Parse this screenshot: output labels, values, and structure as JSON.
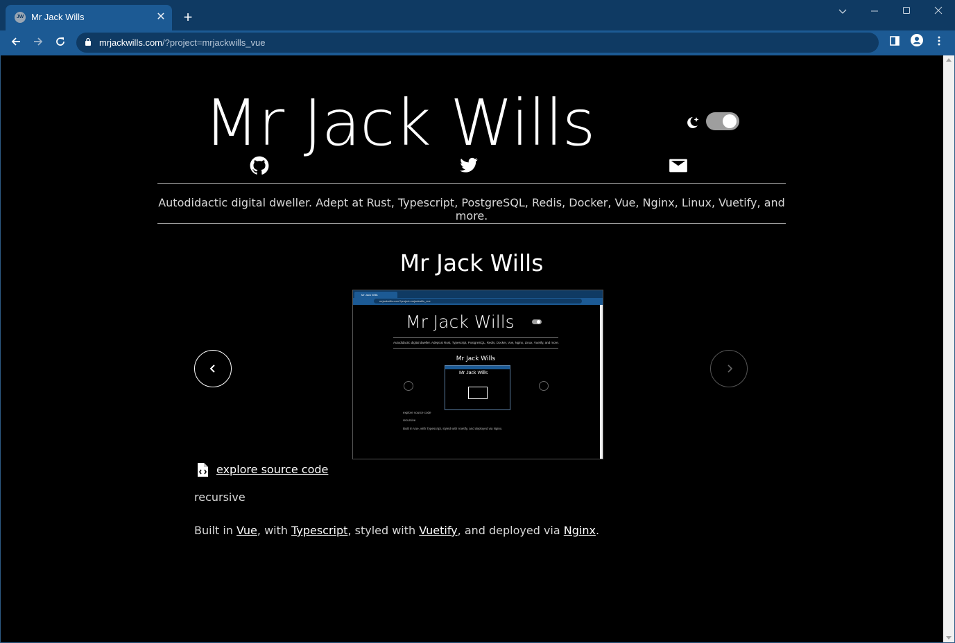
{
  "browser": {
    "tab_title": "Mr Jack Wills",
    "tab_favicon_text": "JW",
    "url_host": "mrjackwills.com",
    "url_path": "/?project=mrjackwills_vue"
  },
  "site": {
    "title": "Mr Jack Wills",
    "dark_mode_enabled": true,
    "social": [
      "github-icon",
      "twitter-icon",
      "email-icon"
    ],
    "tagline": "Autodidactic digital dweller. Adept at Rust, Typescript, PostgreSQL, Redis, Docker, Vue, Nginx, Linux, Vuetify, and more."
  },
  "project": {
    "title": "Mr Jack Wills",
    "source_link": "explore source code",
    "description": "recursive",
    "built": {
      "prefix": "Built in ",
      "t1": "Vue",
      "sep1": ", with ",
      "t2": "Typescript",
      "sep2": ", styled with ",
      "t3": "Vuetify",
      "sep3": ", and deployed via ",
      "t4": "Nginx",
      "suffix": "."
    }
  },
  "screenshot": {
    "tab_title": "Mr Jack Wills",
    "url": "mrjackwills.com/?project=mrjackwills_vue",
    "title": "Mr Jack Wills",
    "tagline": "Autodidactic digital dweller. Adept at Rust, Typescript, PostgreSQL, Redis, Docker, Vue, Nginx, Linux, Vuetify, and more.",
    "project_title": "Mr Jack Wills",
    "inner_title": "Mr Jack Wills",
    "source_link": "explore source code",
    "description": "recursive",
    "built": "Built in Vue, with Typescript, styled with Vuetify, and deployed via Nginx."
  },
  "colors": {
    "titlebar": "#0f3a63",
    "toolbar": "#1c5a94",
    "page_bg": "#000000",
    "toggle_track": "#9e9e9e"
  }
}
